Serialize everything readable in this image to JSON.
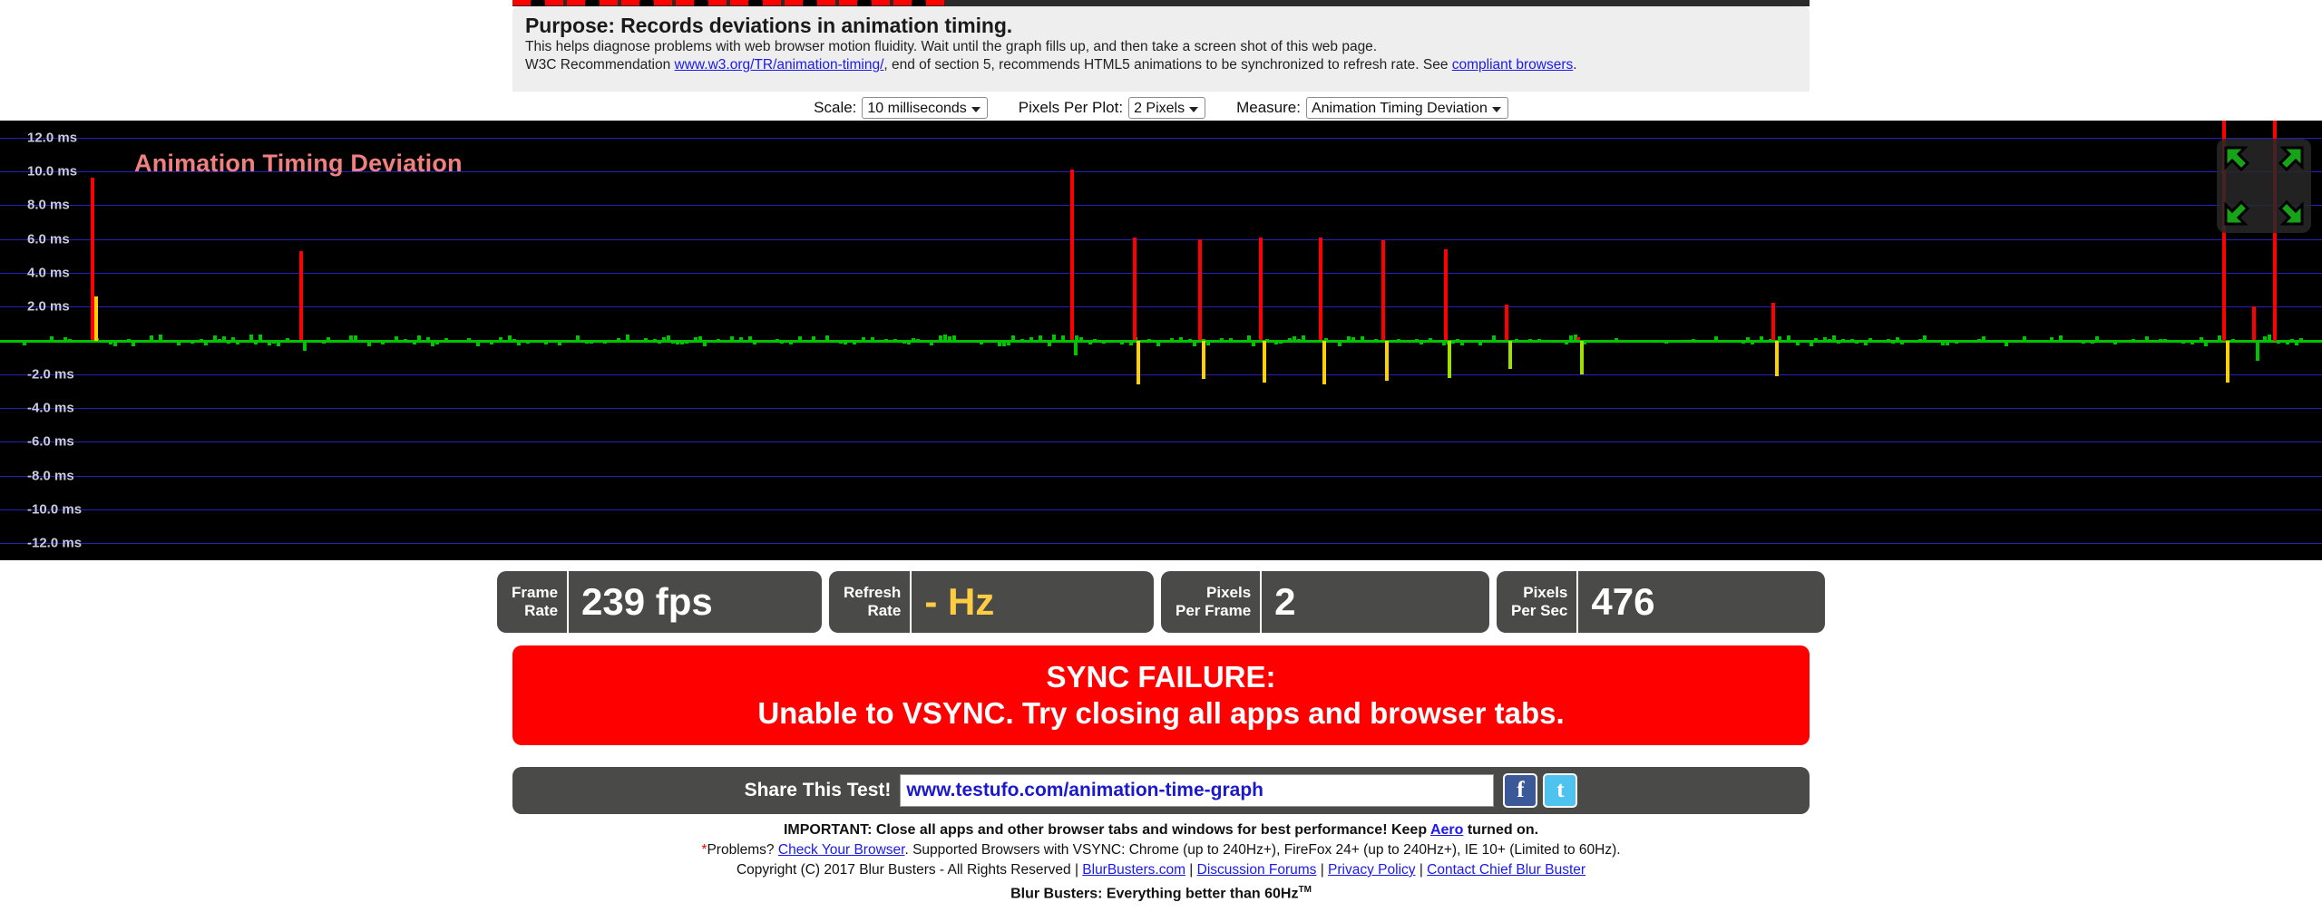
{
  "info": {
    "purpose": "Purpose: Records deviations in animation timing.",
    "line1": "This helps diagnose problems with web browser motion fluidity. Wait until the graph fills up, and then take a screen shot of this web page.",
    "line2_a": "W3C Recommendation ",
    "line2_link1": "www.w3.org/TR/animation-timing/",
    "line2_b": ", end of section 5, recommends HTML5 animations to be synchronized to refresh rate. See ",
    "line2_link2": "compliant browsers",
    "line2_c": "."
  },
  "controls": {
    "scale_label": "Scale:",
    "scale_value": "10 milliseconds",
    "scale_options": [
      "10 milliseconds"
    ],
    "ppp_label": "Pixels Per Plot:",
    "ppp_value": "2 Pixels",
    "ppp_options": [
      "2 Pixels"
    ],
    "measure_label": "Measure:",
    "measure_value": "Animation Timing Deviation",
    "measure_options": [
      "Animation Timing Deviation"
    ]
  },
  "graph": {
    "title": "Animation Timing Deviation",
    "title_color": "#f08080",
    "background": "#000000",
    "grid_color": "#2222bb",
    "trace_color": "#00c400",
    "spike_up_color": "#ff0000",
    "spike_down_color": "#ffd000",
    "fullscreen_icon": "fullscreen-expand-icon"
  },
  "chart_data": {
    "type": "line",
    "title": "Animation Timing Deviation",
    "xlabel": "",
    "ylabel": "ms",
    "ylim": [
      -13.0,
      13.0
    ],
    "grid": true,
    "legend": null,
    "yticks": [
      12.0,
      10.0,
      8.0,
      6.0,
      4.0,
      2.0,
      -2.0,
      -4.0,
      -6.0,
      -8.0,
      -10.0,
      -12.0
    ],
    "ytick_labels": [
      "12.0 ms",
      "10.0 ms",
      "8.0 ms",
      "6.0 ms",
      "4.0 ms",
      "2.0 ms",
      "-2.0 ms",
      "-4.0 ms",
      "-6.0 ms",
      "-8.0 ms",
      "-10.0 ms",
      "-12.0 ms"
    ],
    "baseline_value": 0.0,
    "series": [
      {
        "name": "Animation Timing Deviation",
        "units": "ms",
        "baseline_noise_amplitude": 0.35,
        "spikes": [
          {
            "x_pct": 3.9,
            "up": 9.6,
            "down": -0.1,
            "down_color": "#ffd000",
            "down_from": 2.6
          },
          {
            "x_pct": 12.9,
            "up": 5.3,
            "down": -0.6,
            "down_color": "#00c400"
          },
          {
            "x_pct": 46.1,
            "up": 10.1,
            "down": -0.9,
            "down_color": "#00c400"
          },
          {
            "x_pct": 48.8,
            "up": 6.1,
            "down": -2.6,
            "down_color": "#ffd000"
          },
          {
            "x_pct": 51.6,
            "up": 6.0,
            "down": -2.3,
            "down_color": "#ffd000"
          },
          {
            "x_pct": 54.2,
            "up": 6.1,
            "down": -2.5,
            "down_color": "#ffd000"
          },
          {
            "x_pct": 56.8,
            "up": 6.1,
            "down": -2.6,
            "down_color": "#ffd000"
          },
          {
            "x_pct": 59.5,
            "up": 5.9,
            "down": -2.4,
            "down_color": "#ffd000"
          },
          {
            "x_pct": 62.2,
            "up": 5.4,
            "down": -2.2,
            "down_color": "#9fe000"
          },
          {
            "x_pct": 64.8,
            "up": 2.1,
            "down": -1.7,
            "down_color": "#9fe000"
          },
          {
            "x_pct": 67.9,
            "up": 0.2,
            "down": -2.0,
            "down_color": "#9fe000"
          },
          {
            "x_pct": 76.3,
            "up": 2.2,
            "down": -2.1,
            "down_color": "#ffd000"
          },
          {
            "x_pct": 95.7,
            "up": 13.0,
            "down": -2.5,
            "down_color": "#ffd000"
          },
          {
            "x_pct": 97.0,
            "up": 2.0,
            "down": -1.2,
            "down_color": "#00c400"
          },
          {
            "x_pct": 97.9,
            "up": 13.0,
            "down": -0.2,
            "down_color": "#00c400"
          }
        ]
      }
    ]
  },
  "stats": [
    {
      "id": "stat-frame",
      "label": "Frame\nRate",
      "value": "239 fps",
      "warn": false
    },
    {
      "id": "stat-refresh",
      "label": "Refresh\nRate",
      "value": "- Hz",
      "warn": true
    },
    {
      "id": "stat-ppf",
      "label": "Pixels\nPer Frame",
      "value": "2",
      "warn": false
    },
    {
      "id": "stat-pps",
      "label": "Pixels\nPer Sec",
      "value": "476",
      "warn": false
    }
  ],
  "sync_banner": {
    "line1": "SYNC FAILURE:",
    "line2": "Unable to VSYNC. Try closing all apps and browser tabs.",
    "background": "#ff0000"
  },
  "share": {
    "label": "Share This Test!",
    "url": "www.testufo.com/animation-time-graph",
    "facebook_icon": "f",
    "twitter_icon": "t"
  },
  "footer": {
    "important_a": "IMPORTANT: Close all apps and other browser tabs and windows for best performance! Keep ",
    "important_link": "Aero",
    "important_b": " turned on.",
    "problems_star": "*",
    "problems_a": "Problems? ",
    "problems_link": "Check Your Browser",
    "problems_b": ". Supported Browsers with VSYNC: Chrome (up to 240Hz+), FireFox 24+ (up to 240Hz+), IE 10+ (Limited to 60Hz).",
    "copyright_a": "Copyright (C) 2017 Blur Busters - All Rights Reserved | ",
    "copyright_link1": "BlurBusters.com",
    "copyright_sep1": " | ",
    "copyright_link2": "Discussion Forums",
    "copyright_sep2": " | ",
    "copyright_link3": "Privacy Policy",
    "copyright_sep3": " | ",
    "copyright_link4": "Contact Chief Blur Buster",
    "tagline": "Blur Busters: Everything better than 60Hz",
    "tagline_sup": "TM"
  }
}
